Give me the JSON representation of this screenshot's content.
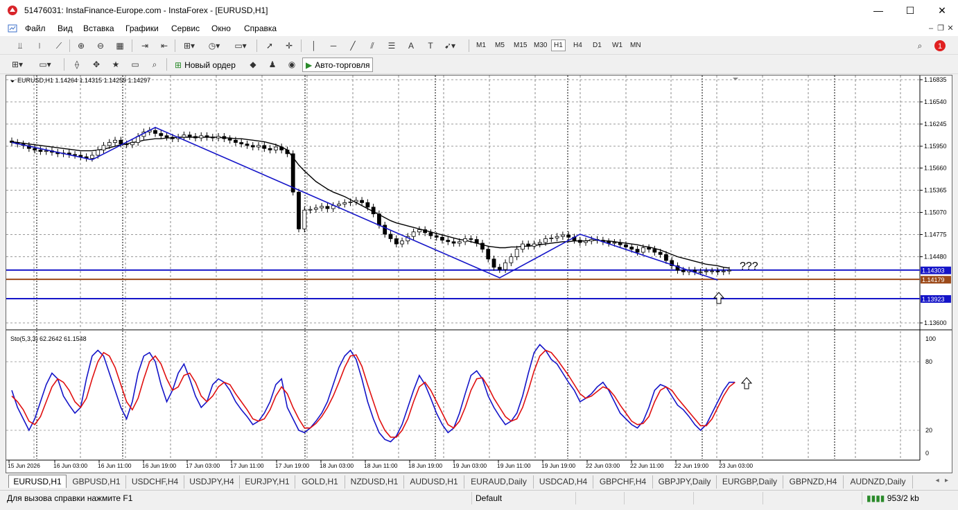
{
  "window": {
    "title": "51476031: InstaFinance-Europe.com - InstaForex - [EURUSD,H1]"
  },
  "menu": [
    "Файл",
    "Вид",
    "Вставка",
    "Графики",
    "Сервис",
    "Окно",
    "Справка"
  ],
  "toolbar": {
    "timeframes": [
      "M1",
      "M5",
      "M15",
      "M30",
      "H1",
      "H4",
      "D1",
      "W1",
      "MN"
    ],
    "active_timeframe": "H1",
    "new_order_label": "Новый ордер",
    "autotrading_label": "Авто-торговля",
    "notification_count": "1"
  },
  "chart": {
    "header": "EURUSD,H1  1.14264 1.14315 1.14259 1.14297",
    "price_ticks": [
      "1.16835",
      "1.16540",
      "1.16245",
      "1.15950",
      "1.15660",
      "1.15365",
      "1.15070",
      "1.14775",
      "1.14480",
      "1.13600"
    ],
    "price_tick_values": [
      1.16835,
      1.1654,
      1.16245,
      1.1595,
      1.1566,
      1.15365,
      1.1507,
      1.14775,
      1.1448,
      1.136
    ],
    "hlines": [
      {
        "label": "1.14303",
        "value": 1.14303,
        "color": "#1414c8"
      },
      {
        "label": "1.14179",
        "value": 1.14179,
        "color": "#9c4a1a"
      },
      {
        "label": "1.13923",
        "value": 1.13923,
        "color": "#1414c8"
      }
    ],
    "annotation": "???",
    "time_labels": [
      "15 Jun 2026",
      "16 Jun 03:00",
      "16 Jun 11:00",
      "16 Jun 19:00",
      "17 Jun 03:00",
      "17 Jun 11:00",
      "17 Jun 19:00",
      "18 Jun 03:00",
      "18 Jun 11:00",
      "18 Jun 19:00",
      "19 Jun 03:00",
      "19 Jun 11:00",
      "19 Jun 19:00",
      "22 Jun 03:00",
      "22 Jun 11:00",
      "22 Jun 19:00",
      "23 Jun 03:00"
    ],
    "close_series": [
      1.16,
      1.1598,
      1.1596,
      1.1592,
      1.159,
      1.1588,
      1.1589,
      1.1587,
      1.1585,
      1.1586,
      1.1584,
      1.1583,
      1.1581,
      1.1579,
      1.1583,
      1.159,
      1.1596,
      1.16,
      1.1603,
      1.1598,
      1.1597,
      1.16,
      1.1608,
      1.1614,
      1.1616,
      1.1612,
      1.1609,
      1.1607,
      1.1605,
      1.1607,
      1.161,
      1.1608,
      1.1606,
      1.1609,
      1.1607,
      1.1606,
      1.1608,
      1.1605,
      1.1603,
      1.16,
      1.1598,
      1.1596,
      1.1594,
      1.1596,
      1.1592,
      1.159,
      1.1594,
      1.159,
      1.1585,
      1.1534,
      1.1485,
      1.151,
      1.1511,
      1.1513,
      1.1515,
      1.1512,
      1.1516,
      1.1518,
      1.152,
      1.1521,
      1.1523,
      1.152,
      1.1514,
      1.1505,
      1.149,
      1.1478,
      1.1472,
      1.1465,
      1.1469,
      1.1475,
      1.1481,
      1.1484,
      1.148,
      1.1476,
      1.1474,
      1.147,
      1.1468,
      1.1466,
      1.1468,
      1.1472,
      1.1471,
      1.1466,
      1.1458,
      1.1445,
      1.1434,
      1.1431,
      1.144,
      1.1448,
      1.1458,
      1.1465,
      1.1462,
      1.1465,
      1.1467,
      1.1472,
      1.1473,
      1.1475,
      1.1477,
      1.1474,
      1.147,
      1.1467,
      1.1469,
      1.1471,
      1.147,
      1.1468,
      1.1466,
      1.1467,
      1.1464,
      1.1461,
      1.1458,
      1.1454,
      1.146,
      1.1458,
      1.1454,
      1.1451,
      1.1443,
      1.1436,
      1.143,
      1.1428,
      1.143,
      1.1428,
      1.1428,
      1.1429,
      1.1429,
      1.1428,
      1.1429,
      1.143
    ],
    "ma_series": [
      1.1601,
      1.16,
      1.1599,
      1.1598,
      1.1597,
      1.1596,
      1.1595,
      1.1594,
      1.1593,
      1.1592,
      1.1591,
      1.159,
      1.1589,
      1.1589,
      1.1589,
      1.159,
      1.1591,
      1.1593,
      1.1595,
      1.1597,
      1.1598,
      1.16,
      1.1601,
      1.1603,
      1.1604,
      1.1605,
      1.1605,
      1.1606,
      1.1606,
      1.1607,
      1.1607,
      1.1607,
      1.1607,
      1.1607,
      1.1607,
      1.1607,
      1.1607,
      1.1606,
      1.1606,
      1.1605,
      1.1605,
      1.1604,
      1.1603,
      1.1602,
      1.1601,
      1.1599,
      1.1597,
      1.1594,
      1.159,
      1.158,
      1.157,
      1.1562,
      1.1555,
      1.1548,
      1.1543,
      1.1538,
      1.1534,
      1.1531,
      1.1528,
      1.1524,
      1.152,
      1.1516,
      1.1512,
      1.1508,
      1.1504,
      1.15,
      1.1496,
      1.1493,
      1.1491,
      1.1489,
      1.1487,
      1.1485,
      1.1483,
      1.1481,
      1.1479,
      1.1477,
      1.1475,
      1.1473,
      1.1471,
      1.147,
      1.1468,
      1.1466,
      1.1464,
      1.1462,
      1.1461,
      1.146,
      1.146,
      1.1461,
      1.1461,
      1.1462,
      1.1462,
      1.1463,
      1.1464,
      1.1465,
      1.1466,
      1.1467,
      1.1468,
      1.1468,
      1.1469,
      1.1469,
      1.1469,
      1.147,
      1.147,
      1.1469,
      1.1469,
      1.1468,
      1.1467,
      1.1466,
      1.1465,
      1.1464,
      1.1462,
      1.1461,
      1.1459,
      1.1457,
      1.1454,
      1.1451,
      1.1448,
      1.1446,
      1.1444,
      1.1442,
      1.144,
      1.1438,
      1.1437,
      1.1436,
      1.1434,
      1.1433
    ],
    "zigzag": [
      [
        1.16,
        0
      ],
      [
        1.1577,
        14
      ],
      [
        1.162,
        25
      ],
      [
        1.142,
        85
      ],
      [
        1.1478,
        99
      ],
      [
        1.1417,
        123
      ]
    ],
    "candle_count": 125
  },
  "stochastic": {
    "label": "Sto(5,3,3) 62.2642 61.1548",
    "levels": [
      "100",
      "80",
      "20",
      "0"
    ],
    "main": [
      55,
      40,
      30,
      20,
      30,
      45,
      60,
      70,
      65,
      50,
      42,
      35,
      40,
      65,
      85,
      90,
      85,
      70,
      55,
      40,
      30,
      45,
      70,
      85,
      88,
      80,
      60,
      45,
      55,
      70,
      78,
      65,
      50,
      40,
      45,
      60,
      65,
      62,
      55,
      45,
      38,
      32,
      25,
      28,
      35,
      45,
      60,
      65,
      40,
      30,
      20,
      18,
      22,
      28,
      35,
      45,
      60,
      75,
      85,
      90,
      82,
      65,
      45,
      30,
      18,
      12,
      10,
      15,
      25,
      40,
      55,
      68,
      60,
      48,
      35,
      25,
      18,
      22,
      35,
      52,
      68,
      72,
      65,
      50,
      40,
      32,
      25,
      28,
      35,
      50,
      70,
      88,
      95,
      90,
      82,
      78,
      70,
      62,
      55,
      45,
      48,
      52,
      58,
      62,
      55,
      45,
      35,
      30,
      25,
      22,
      28,
      40,
      55,
      60,
      58,
      50,
      42,
      38,
      32,
      25,
      20,
      25,
      35,
      45,
      55,
      62,
      62
    ],
    "signal": [
      50,
      45,
      38,
      28,
      25,
      32,
      45,
      58,
      65,
      62,
      55,
      45,
      40,
      48,
      65,
      80,
      88,
      85,
      75,
      60,
      45,
      38,
      48,
      65,
      80,
      85,
      78,
      65,
      55,
      58,
      68,
      70,
      62,
      50,
      45,
      50,
      58,
      62,
      60,
      52,
      45,
      38,
      30,
      28,
      30,
      38,
      50,
      58,
      52,
      40,
      30,
      22,
      22,
      26,
      32,
      40,
      50,
      62,
      75,
      85,
      86,
      76,
      60,
      45,
      30,
      20,
      14,
      14,
      20,
      30,
      45,
      58,
      62,
      55,
      45,
      35,
      25,
      22,
      28,
      40,
      55,
      65,
      66,
      58,
      48,
      40,
      32,
      28,
      30,
      40,
      55,
      72,
      85,
      90,
      88,
      82,
      75,
      68,
      60,
      52,
      48,
      50,
      54,
      58,
      56,
      50,
      42,
      35,
      28,
      25,
      26,
      32,
      45,
      55,
      58,
      55,
      48,
      42,
      36,
      30,
      24,
      24,
      30,
      40,
      50,
      58,
      62
    ]
  },
  "tabs": [
    "EURUSD,H1",
    "GBPUSD,H1",
    "USDCHF,H4",
    "USDJPY,H4",
    "EURJPY,H1",
    "GOLD,H1",
    "NZDUSD,H1",
    "AUDUSD,H1",
    "EURAUD,Daily",
    "USDCAD,H4",
    "GBPCHF,H4",
    "GBPJPY,Daily",
    "EURGBP,Daily",
    "GBPNZD,H4",
    "AUDNZD,Daily"
  ],
  "status": {
    "help": "Для вызова справки нажмите F1",
    "profile": "Default",
    "connection": "953/2 kb"
  },
  "colors": {
    "zigzag": "#1414c8",
    "ma": "#000000",
    "stoch_main": "#1414c8",
    "stoch_signal": "#e01010",
    "bull": "#ffffff",
    "bear": "#000000"
  }
}
